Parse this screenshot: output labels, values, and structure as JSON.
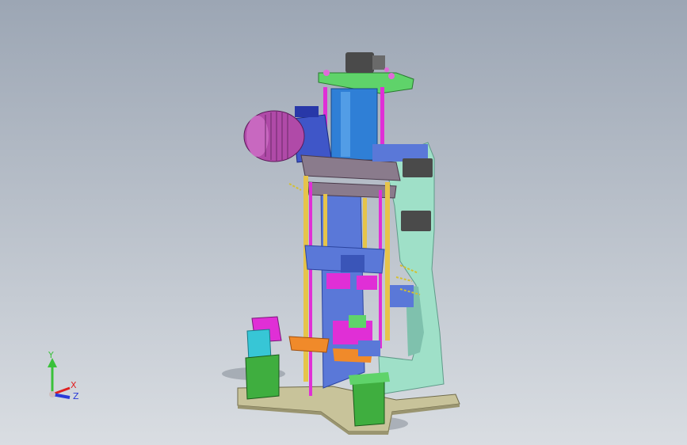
{
  "viewport": {
    "background_top": "#9ca6b4",
    "background_bottom": "#d9dde2"
  },
  "model": {
    "colors": {
      "frame": "#9fe0c8",
      "top_plate": "#5fd36a",
      "cylinder": "#2f7fd6",
      "motor": "#b04aa8",
      "gearbox": "#3f56c8",
      "crossbar": "#8a7b8c",
      "guide_rod": "#e6c44a",
      "magenta_rod": "#e02fd6",
      "fixture_blue": "#5a78d8",
      "orange_block": "#f08a2a",
      "cyan_block": "#37c6d6",
      "green_post": "#3fae3f",
      "base": "#c8c39a",
      "sensor_dark": "#4a4a4a"
    }
  },
  "triad": {
    "y_label": "Y",
    "x_label": "X",
    "z_label": "Z",
    "y_color": "#3ac13a",
    "x_color": "#e02020",
    "z_color": "#2a3ad8"
  }
}
